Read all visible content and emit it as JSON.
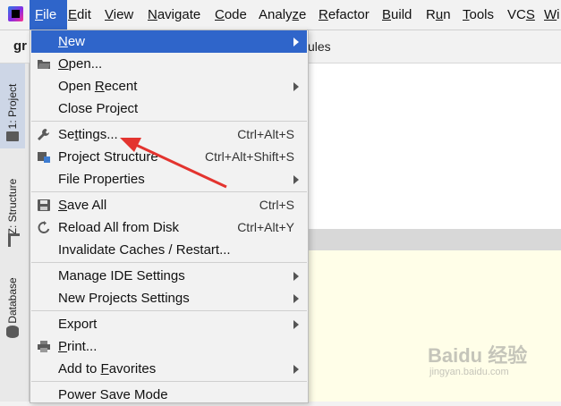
{
  "menubar": {
    "items": [
      {
        "label": "File",
        "mnemonic": "F",
        "rest": "ile"
      },
      {
        "label": "Edit",
        "mnemonic": "E",
        "rest": "dit"
      },
      {
        "label": "View",
        "mnemonic": "V",
        "rest": "iew"
      },
      {
        "label": "Navigate",
        "mnemonic": "N",
        "rest": "avigate"
      },
      {
        "label": "Code",
        "mnemonic": "C",
        "rest": "ode"
      },
      {
        "label": "Analyze",
        "pre": "Analy",
        "mnemonic": "z",
        "rest": "e"
      },
      {
        "label": "Refactor",
        "mnemonic": "R",
        "rest": "efactor"
      },
      {
        "label": "Build",
        "mnemonic": "B",
        "rest": "uild"
      },
      {
        "label": "Run",
        "pre": "R",
        "mnemonic": "u",
        "rest": "n"
      },
      {
        "label": "Tools",
        "mnemonic": "T",
        "rest": "ools"
      },
      {
        "label": "VCS",
        "pre": "VC",
        "mnemonic": "S",
        "rest": ""
      },
      {
        "label": "Wi",
        "mnemonic": "W",
        "rest": "i"
      }
    ]
  },
  "toolbar": {
    "project_name": "gr",
    "breadcrumb_tail": "ules"
  },
  "side_tabs": {
    "project": "1: Project",
    "structure": "Z: Structure",
    "database": "Database"
  },
  "file_menu": {
    "new": {
      "pre": "",
      "mn": "N",
      "rest": "ew"
    },
    "open": {
      "pre": "",
      "mn": "O",
      "rest": "pen..."
    },
    "open_recent": {
      "pre": "Open ",
      "mn": "R",
      "rest": "ecent"
    },
    "close_project": {
      "pre": "Close Pro",
      "mn": "j",
      "rest": "ect"
    },
    "settings": {
      "pre": "Se",
      "mn": "t",
      "rest": "tings...",
      "shortcut": "Ctrl+Alt+S"
    },
    "project_structure": {
      "pre": "Project Structure",
      "mn": "",
      "rest": "",
      "shortcut": "Ctrl+Alt+Shift+S"
    },
    "file_properties": {
      "pre": "File Properties",
      "mn": "",
      "rest": ""
    },
    "save_all": {
      "pre": "",
      "mn": "S",
      "rest": "ave All",
      "shortcut": "Ctrl+S"
    },
    "reload": {
      "pre": "Reload All from Disk",
      "mn": "",
      "rest": "",
      "shortcut": "Ctrl+Alt+Y"
    },
    "invalidate": {
      "pre": "Invalidate Caches / Restart...",
      "mn": "",
      "rest": ""
    },
    "manage_ide": {
      "pre": "Manage IDE Settings",
      "mn": "",
      "rest": ""
    },
    "new_projects": {
      "pre": "New Projects Settings",
      "mn": "",
      "rest": ""
    },
    "export": {
      "pre": "Export",
      "mn": "",
      "rest": ""
    },
    "print": {
      "pre": "",
      "mn": "P",
      "rest": "rint..."
    },
    "favorites": {
      "pre": "Add to ",
      "mn": "F",
      "rest": "avorites"
    },
    "power_save": {
      "pre": "Power Save Mode",
      "mn": "",
      "rest": ""
    }
  },
  "watermark": {
    "title": "Baidu 经验",
    "url": "jingyan.baidu.com"
  },
  "colors": {
    "highlight": "#2f65ca",
    "annotation_arrow": "#e3342f",
    "editor_yellow": "#fffee8"
  }
}
